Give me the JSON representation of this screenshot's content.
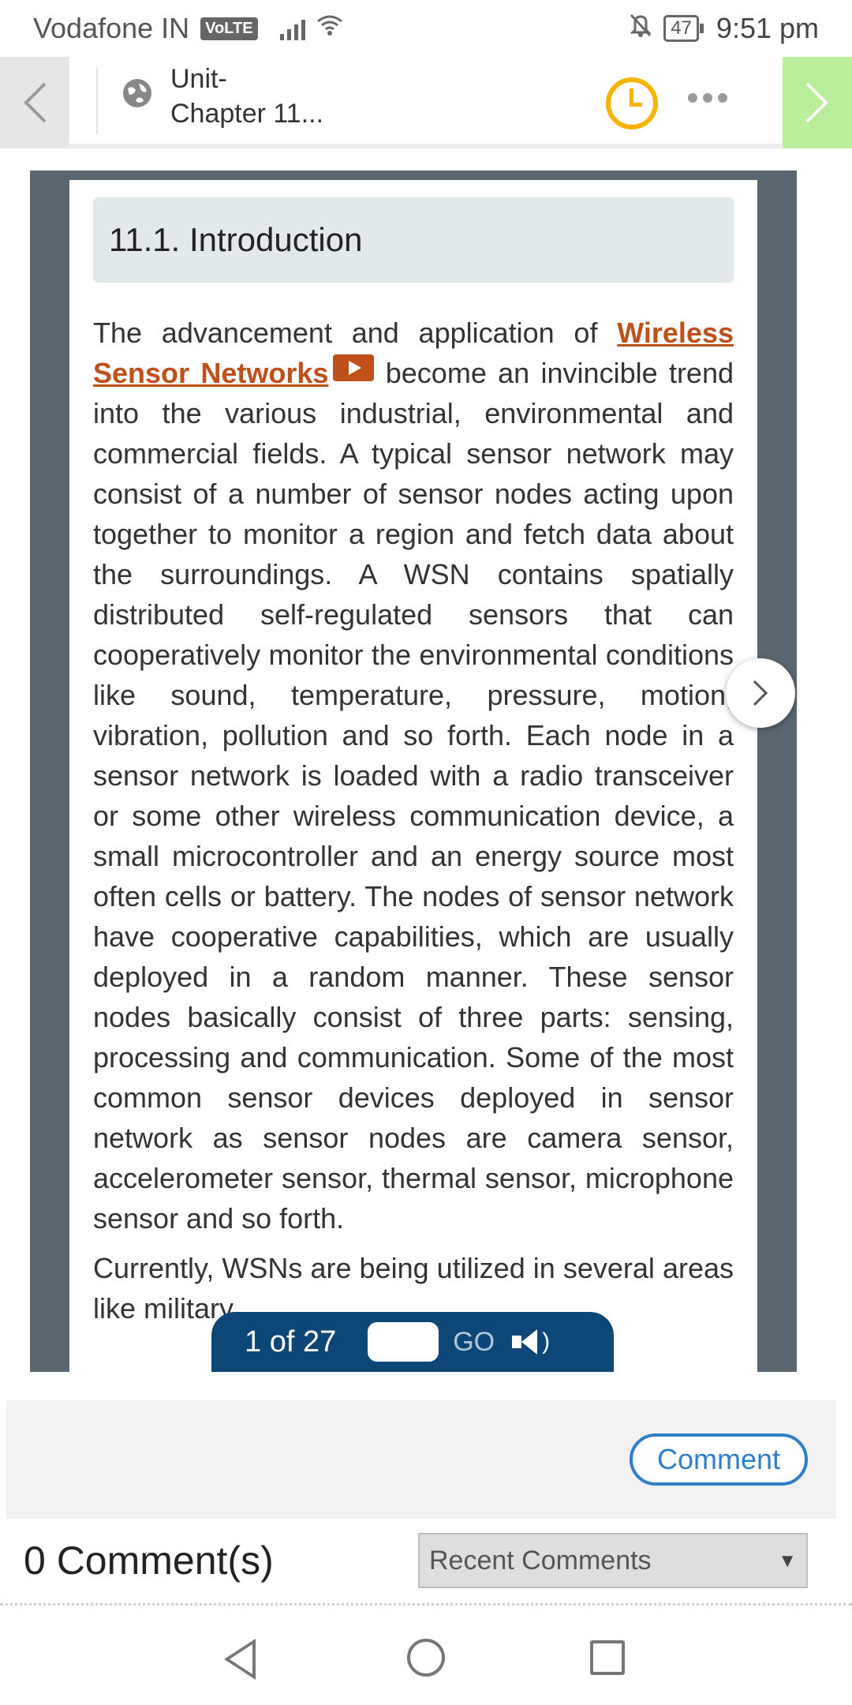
{
  "status_bar": {
    "carrier": "Vodafone IN",
    "volte": "VoLTE",
    "battery": "47",
    "time": "9:51 pm"
  },
  "header": {
    "title_line1": "Unit-",
    "title_line2": "Chapter 11...",
    "prev_icon": "chevron-left",
    "next_icon": "chevron-right"
  },
  "content": {
    "section_heading": "11.1. Introduction",
    "para1_before_link": "The advancement and application of ",
    "para1_link": "Wireless Sensor Networks",
    "para1_after_link": " become an invincible trend into the various industrial, environmental and commercial fields. A typical sensor network may consist of a number of sensor nodes acting upon together to monitor a region and fetch data about the surroundings. A WSN contains spatially distributed self-regulated sensors that can cooperatively monitor the environmental conditions like sound, temperature, pressure, motion, vibration, pollution and so forth. Each node in a sensor network is loaded with a radio transceiver or some other wireless communication device, a small microcontroller and an energy source most often cells or battery. The nodes of sensor network have cooperative capabilities, which are usually deployed in a random manner. These sensor nodes basically consist of three parts: sensing, processing and communication. Some of the most common sensor devices deployed in sensor network as sensor nodes are camera sensor, accelerometer sensor, thermal sensor, microphone sensor and so forth.",
    "para2": "Currently, WSNs are being utilized in several areas like military"
  },
  "pager": {
    "page_status": "1 of 27",
    "page_input_value": "",
    "go_label": "GO"
  },
  "comments": {
    "comment_button": "Comment",
    "count_label": "0 Comment(s)",
    "sort_selected": "Recent Comments",
    "sort_arrow": "▼"
  }
}
